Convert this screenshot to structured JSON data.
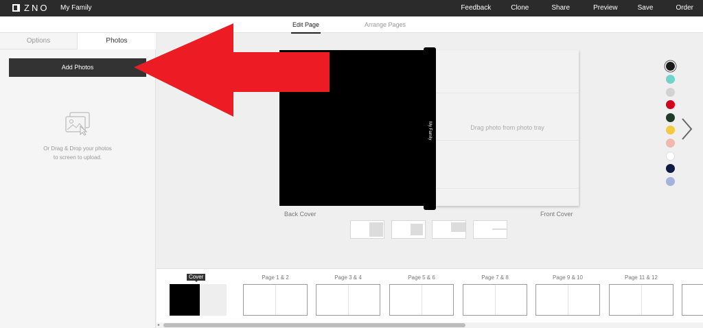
{
  "topbar": {
    "logo_text": "ZNO",
    "project_title": "My Family",
    "actions": [
      "Feedback",
      "Clone",
      "Share",
      "Preview",
      "Save",
      "Order"
    ]
  },
  "subbar": {
    "tabs": [
      {
        "label": "Edit Page",
        "active": true
      },
      {
        "label": "Arrange Pages",
        "active": false
      }
    ]
  },
  "left_panel": {
    "tabs": [
      {
        "label": "Options",
        "active": false
      },
      {
        "label": "Photos",
        "active": true
      }
    ],
    "add_photos_label": "Add Photos",
    "upload_icon": "photos-upload-icon",
    "drop_hint_line1": "Or Drag & Drop your photos",
    "drop_hint_line2": "to screen to upload."
  },
  "annotation": {
    "icon": "red-arrow",
    "color": "#ed1c24"
  },
  "spread": {
    "spine_text": "My Family",
    "front_hint": "Drag photo from photo tray",
    "back_label": "Back Cover",
    "front_label": "Front Cover"
  },
  "swatches": [
    {
      "color": "#1a1a1a",
      "selected": true
    },
    {
      "color": "#6fd3c8",
      "selected": false
    },
    {
      "color": "#d2d2d2",
      "selected": false
    },
    {
      "color": "#d0021b",
      "selected": false
    },
    {
      "color": "#1f3a2b",
      "selected": false
    },
    {
      "color": "#f5c842",
      "selected": false
    },
    {
      "color": "#f3b8ad",
      "selected": false
    },
    {
      "color": "#ffffff",
      "selected": false
    },
    {
      "color": "#0f1b44",
      "selected": false
    },
    {
      "color": "#a3b3dd",
      "selected": false
    }
  ],
  "next_icon": "chevron-right-icon",
  "pages": {
    "cover_label": "Cover",
    "labels": [
      "Page 1 & 2",
      "Page 3 & 4",
      "Page 5 & 6",
      "Page 7 & 8",
      "Page 9 & 10",
      "Page 11 & 12"
    ]
  }
}
